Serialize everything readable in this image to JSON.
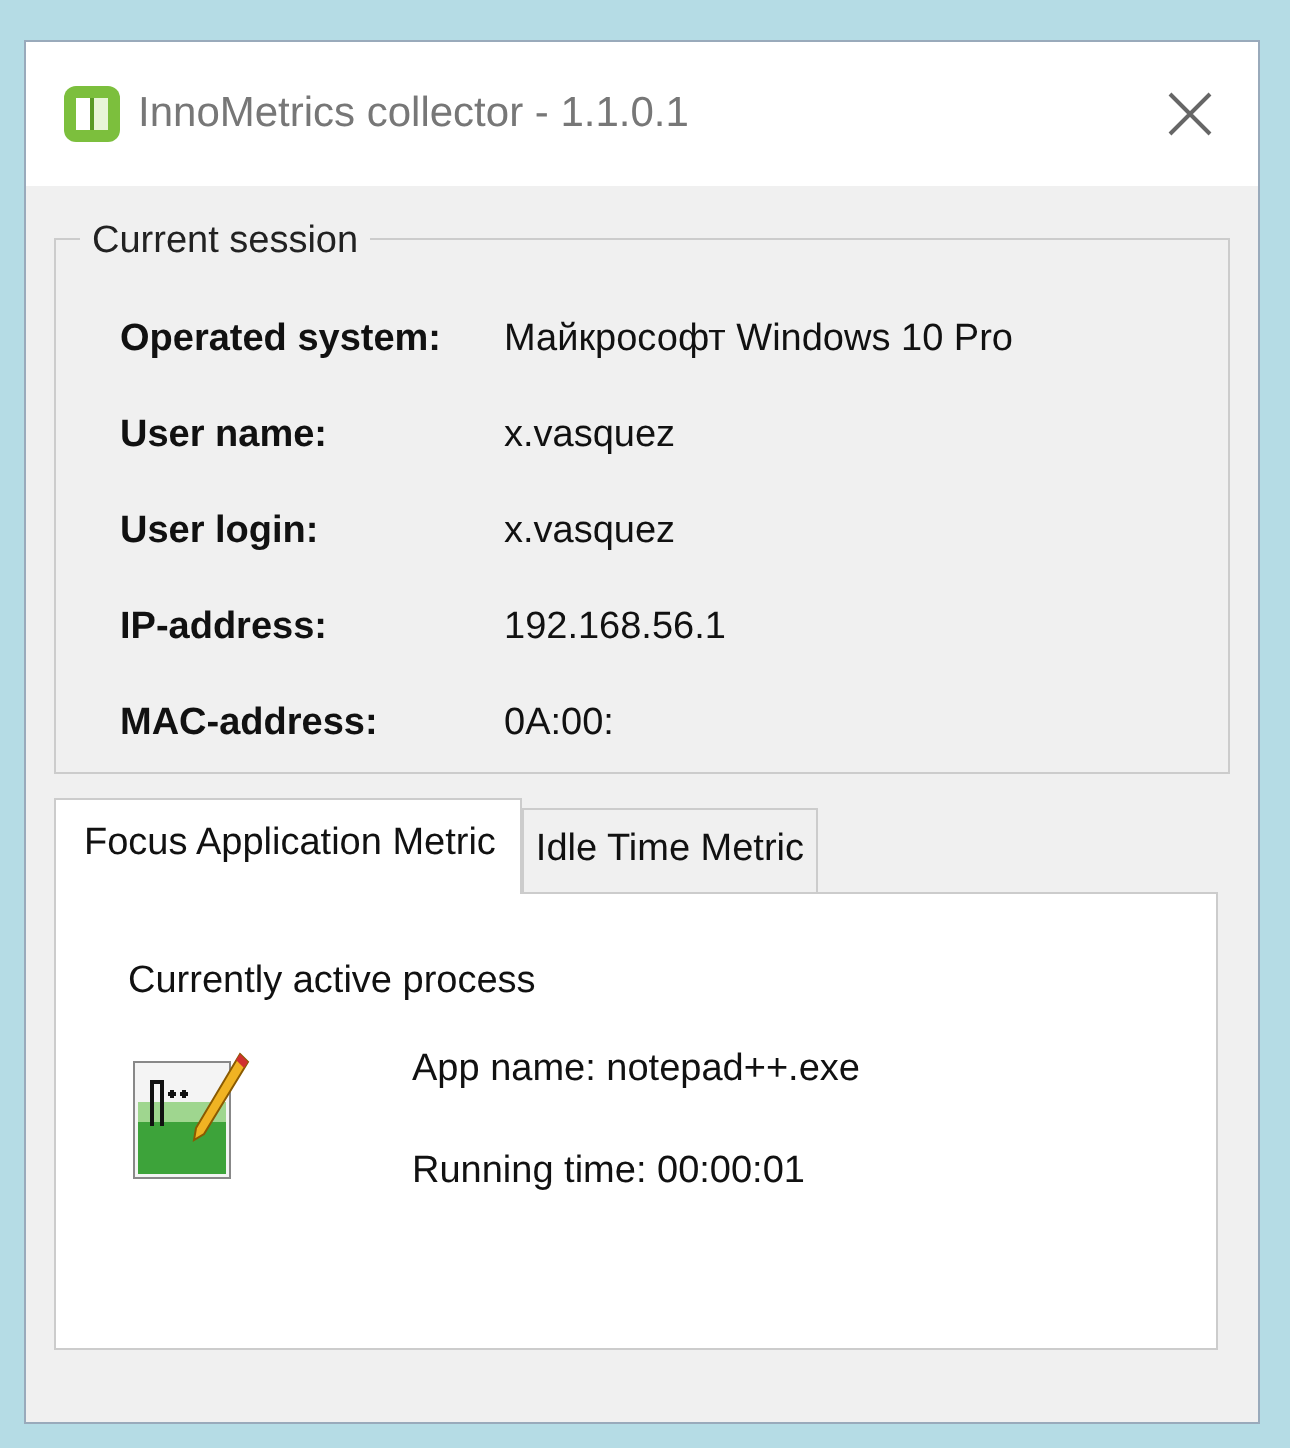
{
  "window": {
    "title": "InnoMetrics collector - 1.1.0.1"
  },
  "session": {
    "title": "Current session",
    "fields": [
      {
        "label": "Operated system:",
        "value": "Майкрософт Windows 10 Pro"
      },
      {
        "label": "User name:",
        "value": "x.vasquez"
      },
      {
        "label": "User login:",
        "value": "x.vasquez"
      },
      {
        "label": "IP-address:",
        "value": "192.168.56.1"
      },
      {
        "label": "MAC-address:",
        "value": "0A:00:"
      }
    ]
  },
  "tabs": [
    {
      "label": "Focus Application Metric",
      "selected": true
    },
    {
      "label": "Idle Time Metric",
      "selected": false
    }
  ],
  "panel": {
    "heading": "Currently active process",
    "lines": [
      "App name: notepad++.exe",
      "Running time: 00:00:01"
    ]
  }
}
